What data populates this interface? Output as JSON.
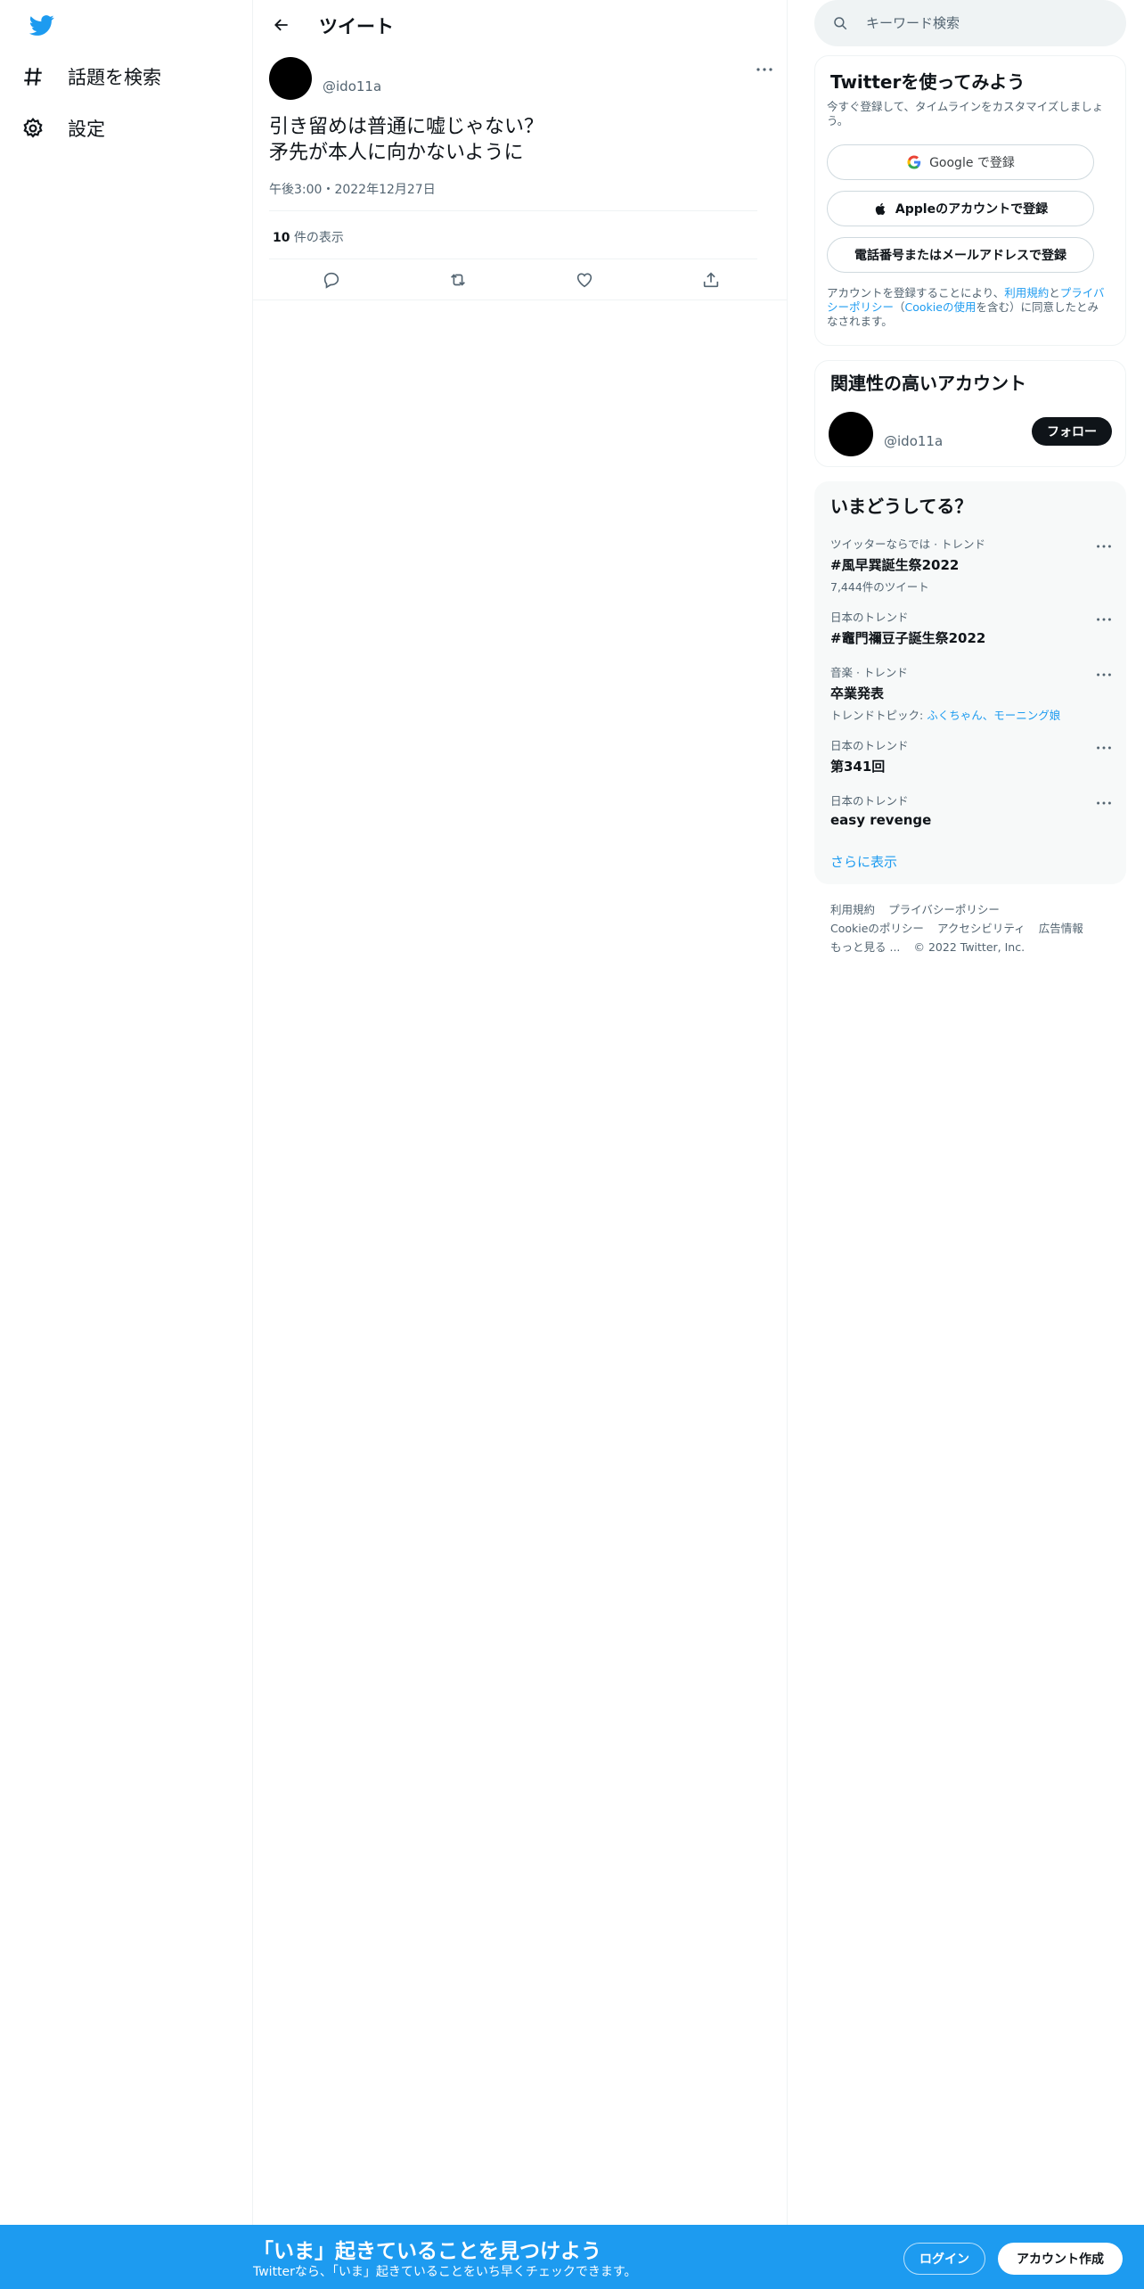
{
  "nav": {
    "items": [
      {
        "label": "話題を検索",
        "icon": "hashtag-icon"
      },
      {
        "label": "設定",
        "icon": "gear-icon"
      }
    ]
  },
  "header": {
    "title": "ツイート"
  },
  "tweet": {
    "handle": "@ido11a",
    "text": "引き留めは普通に嘘じゃない？\n矛先が本人に向かないように",
    "meta": "午後3:00・2022年12月27日",
    "views_count": "10",
    "views_label": " 件の表示"
  },
  "search": {
    "placeholder": "キーワード検索"
  },
  "signup": {
    "title": "Twitterを使ってみよう",
    "subtitle": "今すぐ登録して、タイムラインをカスタマイズしましょう。",
    "google_label": "Google で登録",
    "apple_label": "Appleのアカウントで登録",
    "phone_label": "電話番号またはメールアドレスで登録",
    "legal_prefix": "アカウントを登録することにより、",
    "legal_terms": "利用規約",
    "legal_and": "と",
    "legal_privacy": "プライバシーポリシー",
    "legal_paren_open": "（",
    "legal_cookie": "Cookieの使用",
    "legal_suffix": "を含む）に同意したとみなされます。"
  },
  "related": {
    "title": "関連性の高いアカウント",
    "handle": "@ido11a",
    "follow_label": "フォロー"
  },
  "trends": {
    "title": "いまどうしてる？",
    "items": [
      {
        "context": "ツイッターならでは · トレンド",
        "name": "#風早巽誕生祭2022",
        "extra": "7,444件のツイート"
      },
      {
        "context": "日本のトレンド",
        "name": "#竈門禰豆子誕生祭2022"
      },
      {
        "context": "音楽 · トレンド",
        "name": "卒業発表",
        "extra_prefix": "トレンドトピック: ",
        "extra_link": "ふくちゃん、モーニング娘"
      },
      {
        "context": "日本のトレンド",
        "name": "第341回"
      },
      {
        "context": "日本のトレンド",
        "name": "easy revenge"
      }
    ],
    "show_more": "さらに表示"
  },
  "footer": {
    "terms": "利用規約",
    "privacy": "プライバシーポリシー",
    "cookie": "Cookieのポリシー",
    "accessibility": "アクセシビリティ",
    "ads": "広告情報",
    "more": "もっと見る ...",
    "copyright": "© 2022 Twitter, Inc."
  },
  "banner": {
    "title": "「いま」起きていることを見つけよう",
    "subtitle": "Twitterなら、「いま」起きていることをいち早くチェックできます。",
    "login_label": "ログイン",
    "signup_label": "アカウント作成"
  },
  "colors": {
    "accent": "#1d9bf0",
    "text": "#0f1419",
    "secondary": "#536471"
  }
}
